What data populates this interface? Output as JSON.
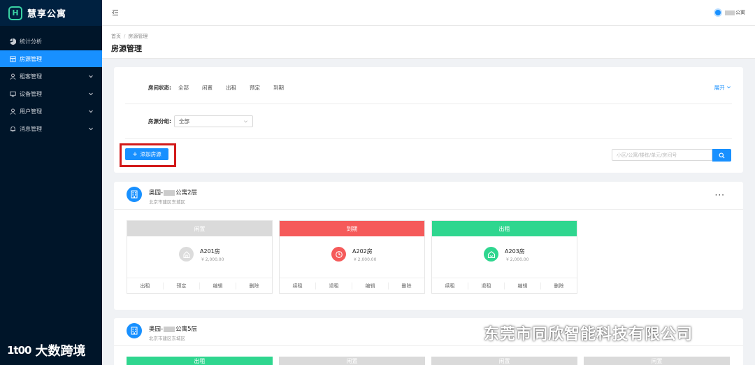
{
  "app": {
    "name": "慧享公寓",
    "logo_letter": "H"
  },
  "sidebar": {
    "items": [
      {
        "label": "统计分析",
        "icon": "pie-chart-icon",
        "active": false,
        "expandable": false
      },
      {
        "label": "房源管理",
        "icon": "building-icon",
        "active": true,
        "expandable": false
      },
      {
        "label": "租客管理",
        "icon": "user-icon",
        "active": false,
        "expandable": true
      },
      {
        "label": "设备管理",
        "icon": "monitor-icon",
        "active": false,
        "expandable": true
      },
      {
        "label": "用户管理",
        "icon": "user-icon",
        "active": false,
        "expandable": true
      },
      {
        "label": "消息管理",
        "icon": "bell-icon",
        "active": false,
        "expandable": true
      }
    ],
    "watermark": "大数跨境",
    "watermark_mark": "1t00"
  },
  "header": {
    "user_suffix": "公寓"
  },
  "breadcrumb": {
    "home": "首页",
    "current": "房源管理",
    "sep": "/"
  },
  "page": {
    "title": "房源管理"
  },
  "filters": {
    "status_label": "房间状态",
    "label_colon": ":",
    "status_options": [
      "全部",
      "闲置",
      "出租",
      "预定",
      "到期"
    ],
    "expand_label": "展开",
    "group_label": "房源分组",
    "group_value": "全部"
  },
  "actions": {
    "add_label": "添加房源",
    "add_plus": "+",
    "search_placeholder": "小区/公寓/楼栋/单元/房间号"
  },
  "buildings": [
    {
      "name_prefix": "奥园-",
      "name_suffix": "公寓2层",
      "address": "北京市建区东城区",
      "more": "···",
      "rooms": [
        {
          "status": "闲置",
          "status_color": "#dadada",
          "icon_color": "#dcdcdc",
          "name": "A201房",
          "price": "¥ 2,000.00",
          "actions": [
            "出租",
            "预定",
            "编辑",
            "删除"
          ]
        },
        {
          "status": "到期",
          "status_color": "#f55a5a",
          "icon_color": "#f55a5a",
          "name": "A202房",
          "price": "¥ 2,000.00",
          "actions": [
            "续租",
            "退租",
            "编辑",
            "删除"
          ]
        },
        {
          "status": "出租",
          "status_color": "#2fd68f",
          "icon_color": "#2fd68f",
          "name": "A203房",
          "price": "¥ 2,000.00",
          "actions": [
            "续租",
            "退租",
            "编辑",
            "删除"
          ]
        }
      ]
    },
    {
      "name_prefix": "奥园-",
      "name_suffix": "公寓5层",
      "address": "北京市建区东城区",
      "rooms": [
        {
          "status": "出租",
          "status_color": "#2fd68f"
        },
        {
          "status": "闲置",
          "status_color": "#dadada"
        },
        {
          "status": "闲置",
          "status_color": "#dadada"
        },
        {
          "status": "闲置",
          "status_color": "#dadada"
        }
      ]
    }
  ],
  "watermark_company": "东莞市同欣智能科技有限公司"
}
